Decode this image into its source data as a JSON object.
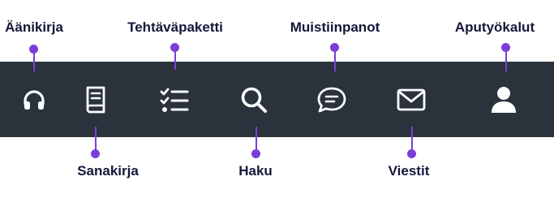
{
  "toolbar": {
    "background": "#2a323c",
    "icon_color": "#ffffff",
    "callout_color": "#7a3ed8",
    "label_color": "#15173a",
    "items": [
      {
        "icon": "headphones-icon",
        "label": "Äänikirja"
      },
      {
        "icon": "book-icon",
        "label": "Sanakirja"
      },
      {
        "icon": "checklist-icon",
        "label": "Tehtäväpaketti"
      },
      {
        "icon": "search-icon",
        "label": "Haku"
      },
      {
        "icon": "chat-bubble-icon",
        "label": "Muistiinpanot"
      },
      {
        "icon": "envelope-icon",
        "label": "Viestit"
      },
      {
        "icon": "user-icon",
        "label": "Aputyökalut"
      }
    ]
  }
}
